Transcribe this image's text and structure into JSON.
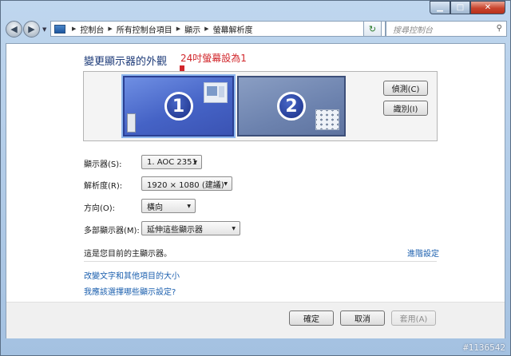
{
  "window": {
    "controls": {
      "minimize_icon": "minimize-icon",
      "maximize_icon": "maximize-icon",
      "close_icon": "close-icon"
    }
  },
  "nav": {
    "breadcrumbs": [
      "控制台",
      "所有控制台項目",
      "顯示",
      "螢幕解析度"
    ],
    "search_placeholder": "搜尋控制台"
  },
  "page": {
    "title": "變更顯示器的外觀",
    "annotation": "24吋螢幕設為1"
  },
  "monitors": [
    {
      "number": "1",
      "selected": true
    },
    {
      "number": "2",
      "selected": false
    }
  ],
  "buttons": {
    "detect": "偵測(C)",
    "identify": "識別(I)",
    "ok": "確定",
    "cancel": "取消",
    "apply": "套用(A)"
  },
  "settings": {
    "display_label": "顯示器(S):",
    "display_value": "1. AOC 2351",
    "resolution_label": "解析度(R):",
    "resolution_value": "1920 × 1080 (建議)",
    "orientation_label": "方向(O):",
    "orientation_value": "橫向",
    "multiple_label": "多部顯示器(M):",
    "multiple_value": "延伸這些顯示器"
  },
  "notes": {
    "primary": "這是您目前的主顯示器。",
    "advanced_link": "進階設定",
    "link_text_size": "改變文字和其他項目的大小",
    "link_which_settings": "我應該選擇哪些顯示設定?"
  },
  "watermark": "#1136542",
  "colors": {
    "accent_link": "#1b5fae",
    "annotation": "#d1262b",
    "title": "#1c3a78"
  }
}
